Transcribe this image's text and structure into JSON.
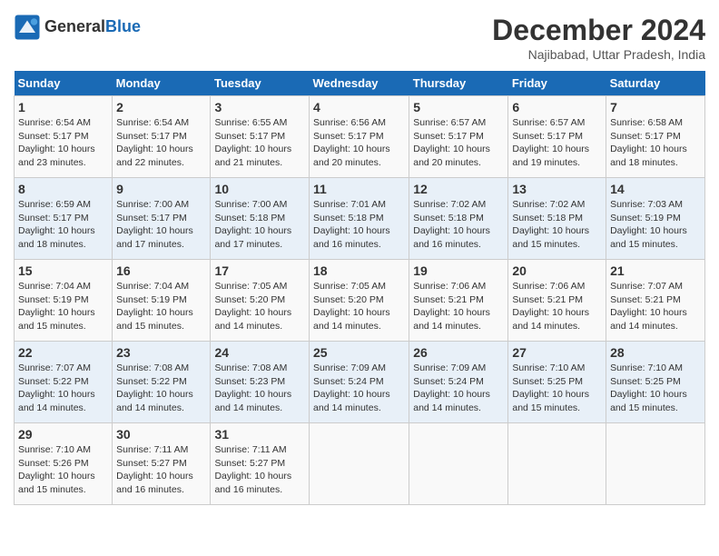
{
  "header": {
    "logo_line1": "General",
    "logo_line2": "Blue",
    "month_title": "December 2024",
    "location": "Najibabad, Uttar Pradesh, India"
  },
  "weekdays": [
    "Sunday",
    "Monday",
    "Tuesday",
    "Wednesday",
    "Thursday",
    "Friday",
    "Saturday"
  ],
  "weeks": [
    [
      {
        "day": 1,
        "info": "Sunrise: 6:54 AM\nSunset: 5:17 PM\nDaylight: 10 hours\nand 23 minutes."
      },
      {
        "day": 2,
        "info": "Sunrise: 6:54 AM\nSunset: 5:17 PM\nDaylight: 10 hours\nand 22 minutes."
      },
      {
        "day": 3,
        "info": "Sunrise: 6:55 AM\nSunset: 5:17 PM\nDaylight: 10 hours\nand 21 minutes."
      },
      {
        "day": 4,
        "info": "Sunrise: 6:56 AM\nSunset: 5:17 PM\nDaylight: 10 hours\nand 20 minutes."
      },
      {
        "day": 5,
        "info": "Sunrise: 6:57 AM\nSunset: 5:17 PM\nDaylight: 10 hours\nand 20 minutes."
      },
      {
        "day": 6,
        "info": "Sunrise: 6:57 AM\nSunset: 5:17 PM\nDaylight: 10 hours\nand 19 minutes."
      },
      {
        "day": 7,
        "info": "Sunrise: 6:58 AM\nSunset: 5:17 PM\nDaylight: 10 hours\nand 18 minutes."
      }
    ],
    [
      {
        "day": 8,
        "info": "Sunrise: 6:59 AM\nSunset: 5:17 PM\nDaylight: 10 hours\nand 18 minutes."
      },
      {
        "day": 9,
        "info": "Sunrise: 7:00 AM\nSunset: 5:17 PM\nDaylight: 10 hours\nand 17 minutes."
      },
      {
        "day": 10,
        "info": "Sunrise: 7:00 AM\nSunset: 5:18 PM\nDaylight: 10 hours\nand 17 minutes."
      },
      {
        "day": 11,
        "info": "Sunrise: 7:01 AM\nSunset: 5:18 PM\nDaylight: 10 hours\nand 16 minutes."
      },
      {
        "day": 12,
        "info": "Sunrise: 7:02 AM\nSunset: 5:18 PM\nDaylight: 10 hours\nand 16 minutes."
      },
      {
        "day": 13,
        "info": "Sunrise: 7:02 AM\nSunset: 5:18 PM\nDaylight: 10 hours\nand 15 minutes."
      },
      {
        "day": 14,
        "info": "Sunrise: 7:03 AM\nSunset: 5:19 PM\nDaylight: 10 hours\nand 15 minutes."
      }
    ],
    [
      {
        "day": 15,
        "info": "Sunrise: 7:04 AM\nSunset: 5:19 PM\nDaylight: 10 hours\nand 15 minutes."
      },
      {
        "day": 16,
        "info": "Sunrise: 7:04 AM\nSunset: 5:19 PM\nDaylight: 10 hours\nand 15 minutes."
      },
      {
        "day": 17,
        "info": "Sunrise: 7:05 AM\nSunset: 5:20 PM\nDaylight: 10 hours\nand 14 minutes."
      },
      {
        "day": 18,
        "info": "Sunrise: 7:05 AM\nSunset: 5:20 PM\nDaylight: 10 hours\nand 14 minutes."
      },
      {
        "day": 19,
        "info": "Sunrise: 7:06 AM\nSunset: 5:21 PM\nDaylight: 10 hours\nand 14 minutes."
      },
      {
        "day": 20,
        "info": "Sunrise: 7:06 AM\nSunset: 5:21 PM\nDaylight: 10 hours\nand 14 minutes."
      },
      {
        "day": 21,
        "info": "Sunrise: 7:07 AM\nSunset: 5:21 PM\nDaylight: 10 hours\nand 14 minutes."
      }
    ],
    [
      {
        "day": 22,
        "info": "Sunrise: 7:07 AM\nSunset: 5:22 PM\nDaylight: 10 hours\nand 14 minutes."
      },
      {
        "day": 23,
        "info": "Sunrise: 7:08 AM\nSunset: 5:22 PM\nDaylight: 10 hours\nand 14 minutes."
      },
      {
        "day": 24,
        "info": "Sunrise: 7:08 AM\nSunset: 5:23 PM\nDaylight: 10 hours\nand 14 minutes."
      },
      {
        "day": 25,
        "info": "Sunrise: 7:09 AM\nSunset: 5:24 PM\nDaylight: 10 hours\nand 14 minutes."
      },
      {
        "day": 26,
        "info": "Sunrise: 7:09 AM\nSunset: 5:24 PM\nDaylight: 10 hours\nand 14 minutes."
      },
      {
        "day": 27,
        "info": "Sunrise: 7:10 AM\nSunset: 5:25 PM\nDaylight: 10 hours\nand 15 minutes."
      },
      {
        "day": 28,
        "info": "Sunrise: 7:10 AM\nSunset: 5:25 PM\nDaylight: 10 hours\nand 15 minutes."
      }
    ],
    [
      {
        "day": 29,
        "info": "Sunrise: 7:10 AM\nSunset: 5:26 PM\nDaylight: 10 hours\nand 15 minutes."
      },
      {
        "day": 30,
        "info": "Sunrise: 7:11 AM\nSunset: 5:27 PM\nDaylight: 10 hours\nand 16 minutes."
      },
      {
        "day": 31,
        "info": "Sunrise: 7:11 AM\nSunset: 5:27 PM\nDaylight: 10 hours\nand 16 minutes."
      },
      null,
      null,
      null,
      null
    ]
  ]
}
